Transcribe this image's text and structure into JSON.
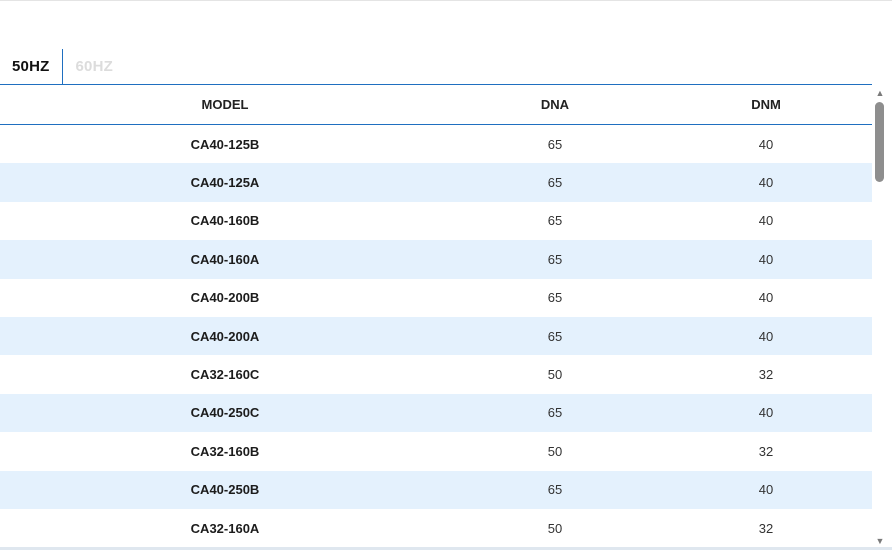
{
  "tabs": [
    {
      "label": "50HZ",
      "active": true
    },
    {
      "label": "60HZ",
      "active": false
    }
  ],
  "table": {
    "columns": [
      "MODEL",
      "DNA",
      "DNM"
    ],
    "rows": [
      {
        "model": "CA40-125B",
        "dna": "65",
        "dnm": "40"
      },
      {
        "model": "CA40-125A",
        "dna": "65",
        "dnm": "40"
      },
      {
        "model": "CA40-160B",
        "dna": "65",
        "dnm": "40"
      },
      {
        "model": "CA40-160A",
        "dna": "65",
        "dnm": "40"
      },
      {
        "model": "CA40-200B",
        "dna": "65",
        "dnm": "40"
      },
      {
        "model": "CA40-200A",
        "dna": "65",
        "dnm": "40"
      },
      {
        "model": "CA32-160C",
        "dna": "50",
        "dnm": "32"
      },
      {
        "model": "CA40-250C",
        "dna": "65",
        "dnm": "40"
      },
      {
        "model": "CA32-160B",
        "dna": "50",
        "dnm": "32"
      },
      {
        "model": "CA40-250B",
        "dna": "65",
        "dnm": "40"
      },
      {
        "model": "CA32-160A",
        "dna": "50",
        "dnm": "32"
      }
    ]
  },
  "scrollbar": {
    "up_icon": "triangle-up-icon",
    "down_icon": "triangle-down-icon"
  },
  "colors": {
    "accent": "#1f6fc0",
    "row_alt": "#e4f1fd",
    "inactive_tab": "#dcdcdc"
  }
}
